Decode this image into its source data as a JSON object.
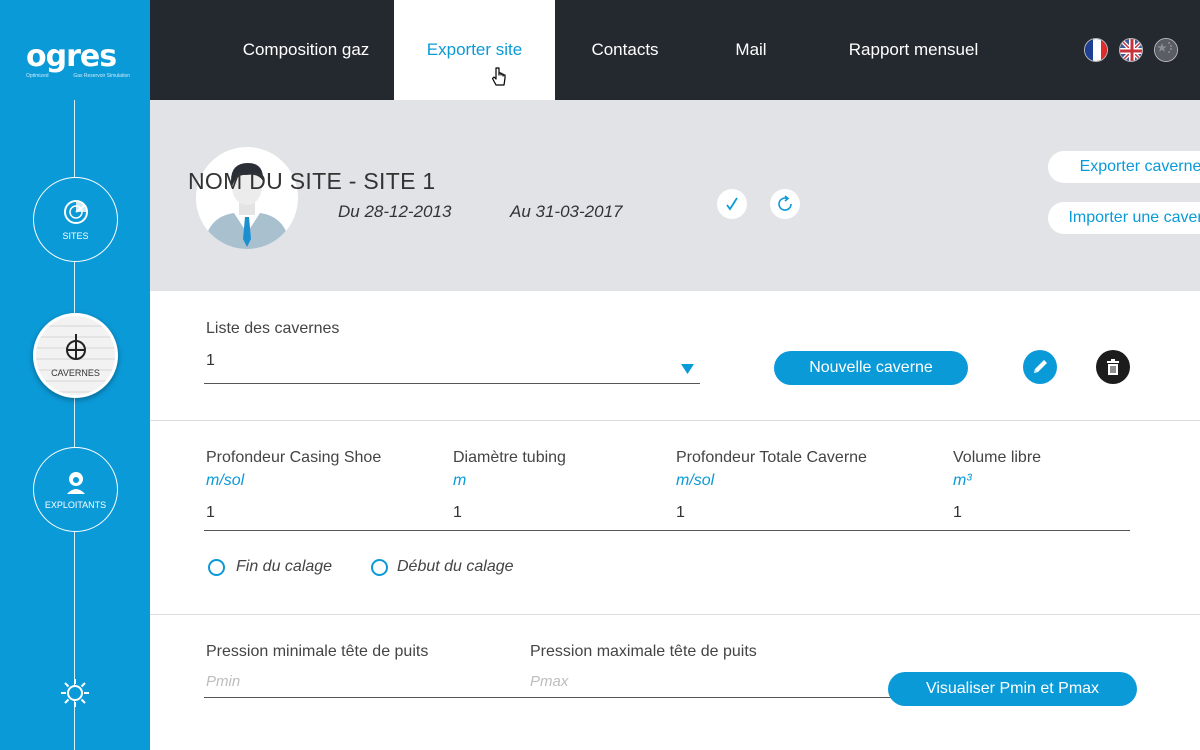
{
  "brand": {
    "name": "ogres",
    "tagline_left": "Optimized",
    "tagline_right": "Gas Reservoir Simulation"
  },
  "sidebar": {
    "items": [
      {
        "label": "SITES",
        "icon": "radar-icon"
      },
      {
        "label": "CAVERNES",
        "icon": "cavern-icon",
        "active": true
      },
      {
        "label": "EXPLOITANTS",
        "icon": "user-icon"
      }
    ],
    "bottom_icon": "sun-settings-icon"
  },
  "topnav": {
    "tabs": [
      {
        "label": "Composition gaz"
      },
      {
        "label": "Exporter site",
        "active": true
      },
      {
        "label": "Contacts"
      },
      {
        "label": "Mail"
      },
      {
        "label": "Rapport mensuel"
      }
    ],
    "languages": [
      "fr-flag-icon",
      "uk-flag-icon",
      "cn-flag-icon"
    ]
  },
  "site": {
    "name": "NOM DU SITE - SITE 1",
    "date_from": "Du 28-12-2013",
    "date_to": "Au 31-03-2017",
    "export_label": "Exporter cavernes",
    "import_label": "Importer une caverne"
  },
  "caverns": {
    "list_label": "Liste des cavernes",
    "selected": "1",
    "new_label": "Nouvelle caverne"
  },
  "fields": [
    {
      "label": "Profondeur Casing Shoe",
      "unit": "m/sol",
      "value": "1"
    },
    {
      "label": "Diamètre tubing",
      "unit": "m",
      "value": "1"
    },
    {
      "label": "Profondeur Totale Caverne",
      "unit": "m/sol",
      "value": "1"
    },
    {
      "label": "Volume libre",
      "unit": "m³",
      "value": "1"
    }
  ],
  "calage": {
    "option_end": "Fin du calage",
    "option_start": "Début du calage"
  },
  "pressure": {
    "min_label": "Pression minimale tête de puits",
    "min_placeholder": "Pmin",
    "max_label": "Pression maximale tête de puits",
    "max_placeholder": "Pmax",
    "visualize_label": "Visualiser Pmin et Pmax"
  },
  "colors": {
    "accent": "#0b9ad8",
    "topnav": "#24282f",
    "header": "#e1e3e7"
  }
}
